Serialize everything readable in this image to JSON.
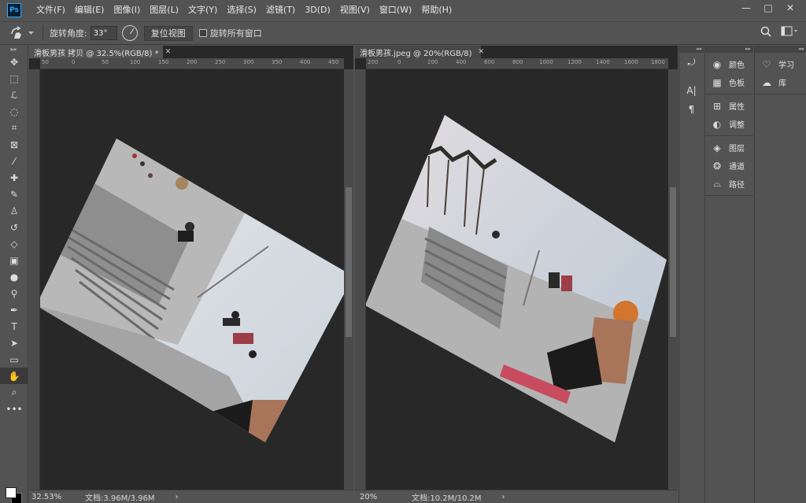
{
  "menubar": {
    "logo": "Ps",
    "items": [
      "文件(F)",
      "编辑(E)",
      "图像(I)",
      "图层(L)",
      "文字(Y)",
      "选择(S)",
      "滤镜(T)",
      "3D(D)",
      "视图(V)",
      "窗口(W)",
      "帮助(H)"
    ],
    "window_controls": [
      "—",
      "□",
      "✕"
    ]
  },
  "options": {
    "rotate_label": "旋转角度:",
    "rotate_value": "33°",
    "reset_view_label": "复位视图",
    "rotate_all_label": "旋转所有窗口"
  },
  "doc1": {
    "tab_title": "滑板男孩 拷贝 @ 32.5%(RGB/8) *",
    "ruler_ticks": [
      "50",
      "0",
      "50",
      "100",
      "150",
      "200",
      "250",
      "300",
      "350",
      "400",
      "450"
    ],
    "zoom": "32.53%",
    "doc_size": "文档:3.96M/3.96M"
  },
  "doc2": {
    "tab_title": "滑板男孩.jpeg @ 20%(RGB/8)",
    "ruler_ticks": [
      "200",
      "0",
      "200",
      "400",
      "600",
      "800",
      "1000",
      "1200",
      "1400",
      "1600",
      "1800"
    ],
    "zoom": "20%",
    "doc_size": "文档:10.2M/10.2M"
  },
  "panels": {
    "group1": [
      "颜色",
      "色板"
    ],
    "group2": [
      "属性",
      "调整"
    ],
    "group3": [
      "图层",
      "通道",
      "路径"
    ],
    "group4": [
      "学习",
      "库"
    ]
  },
  "colors": {
    "foreground": "#ffffff",
    "background": "#000000"
  }
}
